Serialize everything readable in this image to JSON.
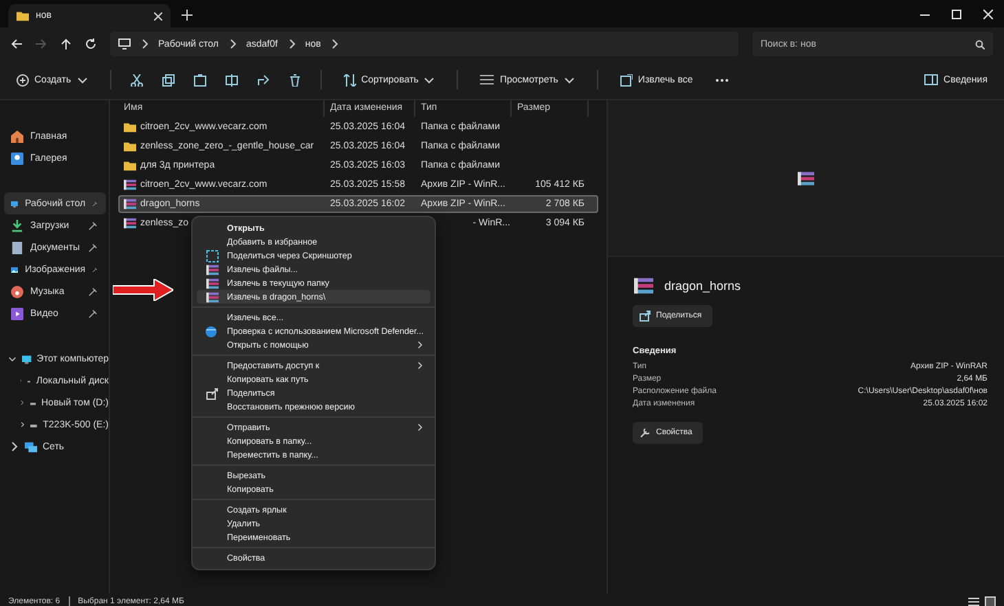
{
  "window": {
    "tab_title": "нов"
  },
  "address": {
    "path": [
      "Рабочий стол",
      "asdaf0f",
      "нов"
    ]
  },
  "search": {
    "placeholder": "Поиск в: нов"
  },
  "toolbar": {
    "create": "Создать",
    "sort": "Сортировать",
    "view": "Просмотреть",
    "extract_all": "Извлечь все",
    "details": "Сведения"
  },
  "sidebar": {
    "items": [
      {
        "label": "Главная",
        "selected": false,
        "pinned": false
      },
      {
        "label": "Галерея",
        "selected": false,
        "pinned": false
      },
      {
        "label": "Рабочий стол",
        "selected": true,
        "pinned": true
      },
      {
        "label": "Загрузки",
        "selected": false,
        "pinned": true
      },
      {
        "label": "Документы",
        "selected": false,
        "pinned": true
      },
      {
        "label": "Изображения",
        "selected": false,
        "pinned": true
      },
      {
        "label": "Музыка",
        "selected": false,
        "pinned": true
      },
      {
        "label": "Видео",
        "selected": false,
        "pinned": true
      }
    ],
    "tree": [
      {
        "label": "Этот компьютер",
        "expanded": true,
        "children": [
          {
            "label": "Локальный диск",
            "expanded": false
          },
          {
            "label": "Новый том (D:)",
            "expanded": false
          },
          {
            "label": "T223K-500 (E:)",
            "expanded": false
          }
        ]
      },
      {
        "label": "Сеть",
        "expanded": false
      }
    ]
  },
  "file_list": {
    "columns": [
      "Имя",
      "Дата изменения",
      "Тип",
      "Размер"
    ],
    "rows": [
      {
        "kind": "folder",
        "name": "citroen_2cv_www.vecarz.com",
        "date": "25.03.2025 16:04",
        "type": "Папка с файлами",
        "selected": false
      },
      {
        "kind": "folder",
        "name": "zenless_zone_zero_-_gentle_house_car",
        "date": "25.03.2025 16:04",
        "type": "Папка с файлами",
        "selected": false
      },
      {
        "kind": "folder",
        "name": "для 3д принтера",
        "date": "25.03.2025 16:03",
        "type": "Папка с файлами",
        "selected": false
      },
      {
        "kind": "archive",
        "name": "citroen_2cv_www.vecarz.com",
        "date": "25.03.2025 15:58",
        "type": "Архив ZIP - WinR...",
        "size": "105 412 КБ",
        "selected": false
      },
      {
        "kind": "archive",
        "name": "dragon_horns",
        "date": "25.03.2025 16:02",
        "type": "Архив ZIP - WinR...",
        "size": "2 708 КБ",
        "selected": true
      },
      {
        "kind": "archive",
        "name": "zenless_zo",
        "type": "- WinR...",
        "size": "3 094 КБ",
        "selected": false
      }
    ]
  },
  "context_menu": {
    "items": [
      {
        "kind": "item",
        "label": "Открыть",
        "bold": true,
        "submenu": false,
        "selected": false
      },
      {
        "kind": "item",
        "label": "Добавить в избранное",
        "bold": false,
        "submenu": false,
        "selected": false
      },
      {
        "kind": "item",
        "label": "Поделиться через Скриншотер",
        "bold": false,
        "submenu": false,
        "selected": false
      },
      {
        "kind": "item",
        "label": "Извлечь файлы...",
        "bold": false,
        "submenu": false,
        "selected": false
      },
      {
        "kind": "item",
        "label": "Извлечь в текущую папку",
        "bold": false,
        "submenu": false,
        "selected": false
      },
      {
        "kind": "item",
        "label": "Извлечь в dragon_horns\\",
        "bold": false,
        "submenu": false,
        "selected": true
      },
      {
        "kind": "separator"
      },
      {
        "kind": "item",
        "label": "Извлечь все...",
        "bold": false,
        "submenu": false,
        "selected": false
      },
      {
        "kind": "item",
        "label": "Проверка с использованием Microsoft Defender...",
        "bold": false,
        "submenu": false,
        "selected": false
      },
      {
        "kind": "item",
        "label": "Открыть с помощью",
        "bold": false,
        "submenu": true,
        "selected": false
      },
      {
        "kind": "separator"
      },
      {
        "kind": "item",
        "label": "Предоставить доступ к",
        "bold": false,
        "submenu": true,
        "selected": false
      },
      {
        "kind": "item",
        "label": "Копировать как путь",
        "bold": false,
        "submenu": false,
        "selected": false
      },
      {
        "kind": "item",
        "label": "Поделиться",
        "bold": false,
        "submenu": false,
        "selected": false
      },
      {
        "kind": "item",
        "label": "Восстановить прежнюю версию",
        "bold": false,
        "submenu": false,
        "selected": false
      },
      {
        "kind": "separator"
      },
      {
        "kind": "item",
        "label": "Отправить",
        "bold": false,
        "submenu": true,
        "selected": false
      },
      {
        "kind": "item",
        "label": "Копировать в папку...",
        "bold": false,
        "submenu": false,
        "selected": false
      },
      {
        "kind": "item",
        "label": "Переместить в папку...",
        "bold": false,
        "submenu": false,
        "selected": false
      },
      {
        "kind": "separator"
      },
      {
        "kind": "item",
        "label": "Вырезать",
        "bold": false,
        "submenu": false,
        "selected": false
      },
      {
        "kind": "item",
        "label": "Копировать",
        "bold": false,
        "submenu": false,
        "selected": false
      },
      {
        "kind": "separator"
      },
      {
        "kind": "item",
        "label": "Создать ярлык",
        "bold": false,
        "submenu": false,
        "selected": false
      },
      {
        "kind": "item",
        "label": "Удалить",
        "bold": false,
        "submenu": false,
        "selected": false
      },
      {
        "kind": "item",
        "label": "Переименовать",
        "bold": false,
        "submenu": false,
        "selected": false
      },
      {
        "kind": "separator"
      },
      {
        "kind": "item",
        "label": "Свойства",
        "bold": false,
        "submenu": false,
        "selected": false
      }
    ]
  },
  "details_pane": {
    "file_name": "dragon_horns",
    "share_button": "Поделиться",
    "heading": "Сведения",
    "properties": [
      {
        "label": "Тип",
        "value": "Архив ZIP - WinRAR"
      },
      {
        "label": "Размер",
        "value": "2,64 МБ"
      },
      {
        "label": "Расположение файла",
        "value": "C:\\Users\\User\\Desktop\\asdaf0f\\нов"
      },
      {
        "label": "Дата изменения",
        "value": "25.03.2025 16:02"
      }
    ],
    "properties_button": "Свойства"
  },
  "status_bar": {
    "count": "Элементов: 6",
    "selection": "Выбран 1 элемент: 2,64 МБ"
  }
}
